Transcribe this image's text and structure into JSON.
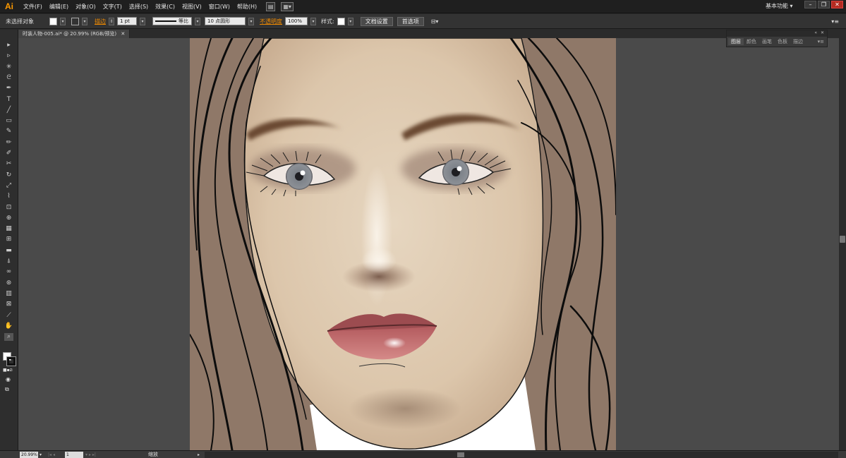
{
  "app": {
    "logo": "Ai"
  },
  "menu": {
    "items": [
      "文件(F)",
      "编辑(E)",
      "对象(O)",
      "文字(T)",
      "选择(S)",
      "效果(C)",
      "视图(V)",
      "窗口(W)",
      "帮助(H)"
    ]
  },
  "workspace": {
    "label": "基本功能"
  },
  "controlbar": {
    "selection_label": "未选择对象",
    "stroke_label": "描边",
    "stroke_weight": "1 pt",
    "stroke_profile": "等比",
    "brush": "10 点圆形",
    "opacity_label": "不透明度",
    "opacity_value": "100%",
    "style_label": "样式:",
    "doc_setup_button": "文档设置",
    "prefs_button": "首选项"
  },
  "document": {
    "tab_title": "时装人物-005.ai* @ 20.99% (RGB/预览)"
  },
  "panel": {
    "tabs": [
      "图层",
      "颜色",
      "画笔",
      "色板",
      "描边"
    ]
  },
  "statusbar": {
    "zoom": "20.99%",
    "page": "1",
    "tool_status": "缩放"
  },
  "colors": {
    "accent": "#ff9a00",
    "hair": "#8f7868",
    "skin": "#e2cfb6",
    "canvas": "#4a4a4a"
  }
}
